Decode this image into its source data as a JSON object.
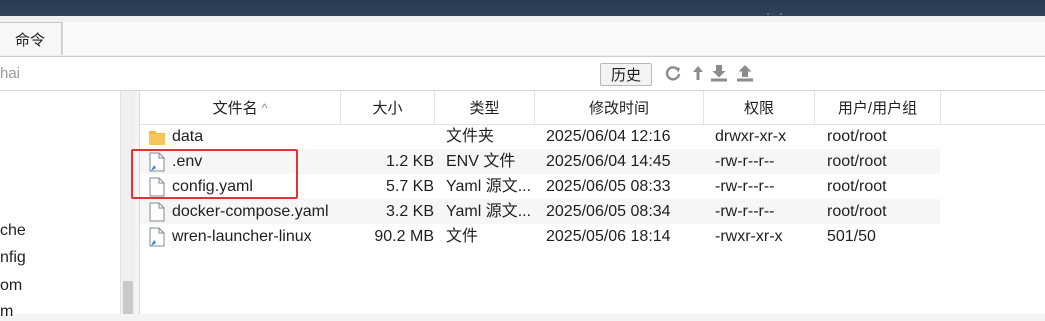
{
  "tabs": {
    "command": "命令"
  },
  "path": {
    "partial_text": "hai"
  },
  "toolbar": {
    "history_label": "历史",
    "icons": [
      "refresh-icon",
      "up-directory-icon",
      "download-icon",
      "upload-icon"
    ]
  },
  "sidebar": {
    "items": [
      {
        "label": "che"
      },
      {
        "label": "nfig"
      },
      {
        "label": "om"
      },
      {
        "label": "m"
      }
    ]
  },
  "table": {
    "columns": [
      "文件名",
      "大小",
      "类型",
      "修改时间",
      "权限",
      "用户/用户组"
    ],
    "sort_indicator": "^",
    "rows": [
      {
        "icon": "folder-icon",
        "name": "data",
        "size": "",
        "type": "文件夹",
        "modified": "2025/06/04 12:16",
        "perm": "drwxr-xr-x",
        "owner": "root/root"
      },
      {
        "icon": "file-icon",
        "name": ".env",
        "size": "1.2 KB",
        "type": "ENV 文件",
        "modified": "2025/06/04 14:45",
        "perm": "-rw-r--r--",
        "owner": "root/root"
      },
      {
        "icon": "file-icon",
        "name": "config.yaml",
        "size": "5.7 KB",
        "type": "Yaml 源文...",
        "modified": "2025/06/05 08:33",
        "perm": "-rw-r--r--",
        "owner": "root/root"
      },
      {
        "icon": "file-icon",
        "name": "docker-compose.yaml",
        "size": "3.2 KB",
        "type": "Yaml 源文...",
        "modified": "2025/06/05 08:34",
        "perm": "-rw-r--r--",
        "owner": "root/root"
      },
      {
        "icon": "file-icon",
        "name": "wren-launcher-linux",
        "size": "90.2 MB",
        "type": "文件",
        "modified": "2025/05/06 18:14",
        "perm": "-rwxr-xr-x",
        "owner": "501/50"
      }
    ]
  },
  "colors": {
    "highlight": "#e03333",
    "folder": "#f4b940",
    "file_accent": "#3d7fd1"
  }
}
